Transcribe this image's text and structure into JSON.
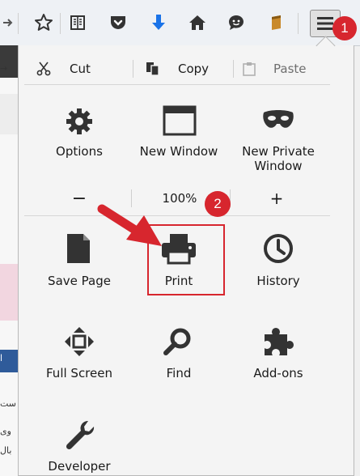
{
  "toolbar": {
    "icons": [
      "arrow-right-icon",
      "star-icon",
      "reading-list-icon",
      "pocket-icon",
      "download-icon",
      "home-icon",
      "hello-icon",
      "library-icon",
      "hamburger-menu-icon"
    ],
    "accent": "#1a73e8"
  },
  "annotations": {
    "step1": "1",
    "step2": "2",
    "color": "#d7262e"
  },
  "edit": {
    "cut": "Cut",
    "copy": "Copy",
    "paste": "Paste"
  },
  "grid": {
    "options": "Options",
    "new_window": "New Window",
    "new_private_line1": "New Private",
    "new_private_line2": "Window",
    "save_page": "Save Page",
    "print": "Print",
    "history": "History",
    "full_screen": "Full Screen",
    "find": "Find",
    "addons": "Add-ons",
    "developer": "Developer"
  },
  "zoom": {
    "minus": "−",
    "level": "100%",
    "plus": "+"
  },
  "background_page": {
    "texts": [
      "→",
      "ا",
      "ست",
      "وی",
      "بال"
    ]
  }
}
